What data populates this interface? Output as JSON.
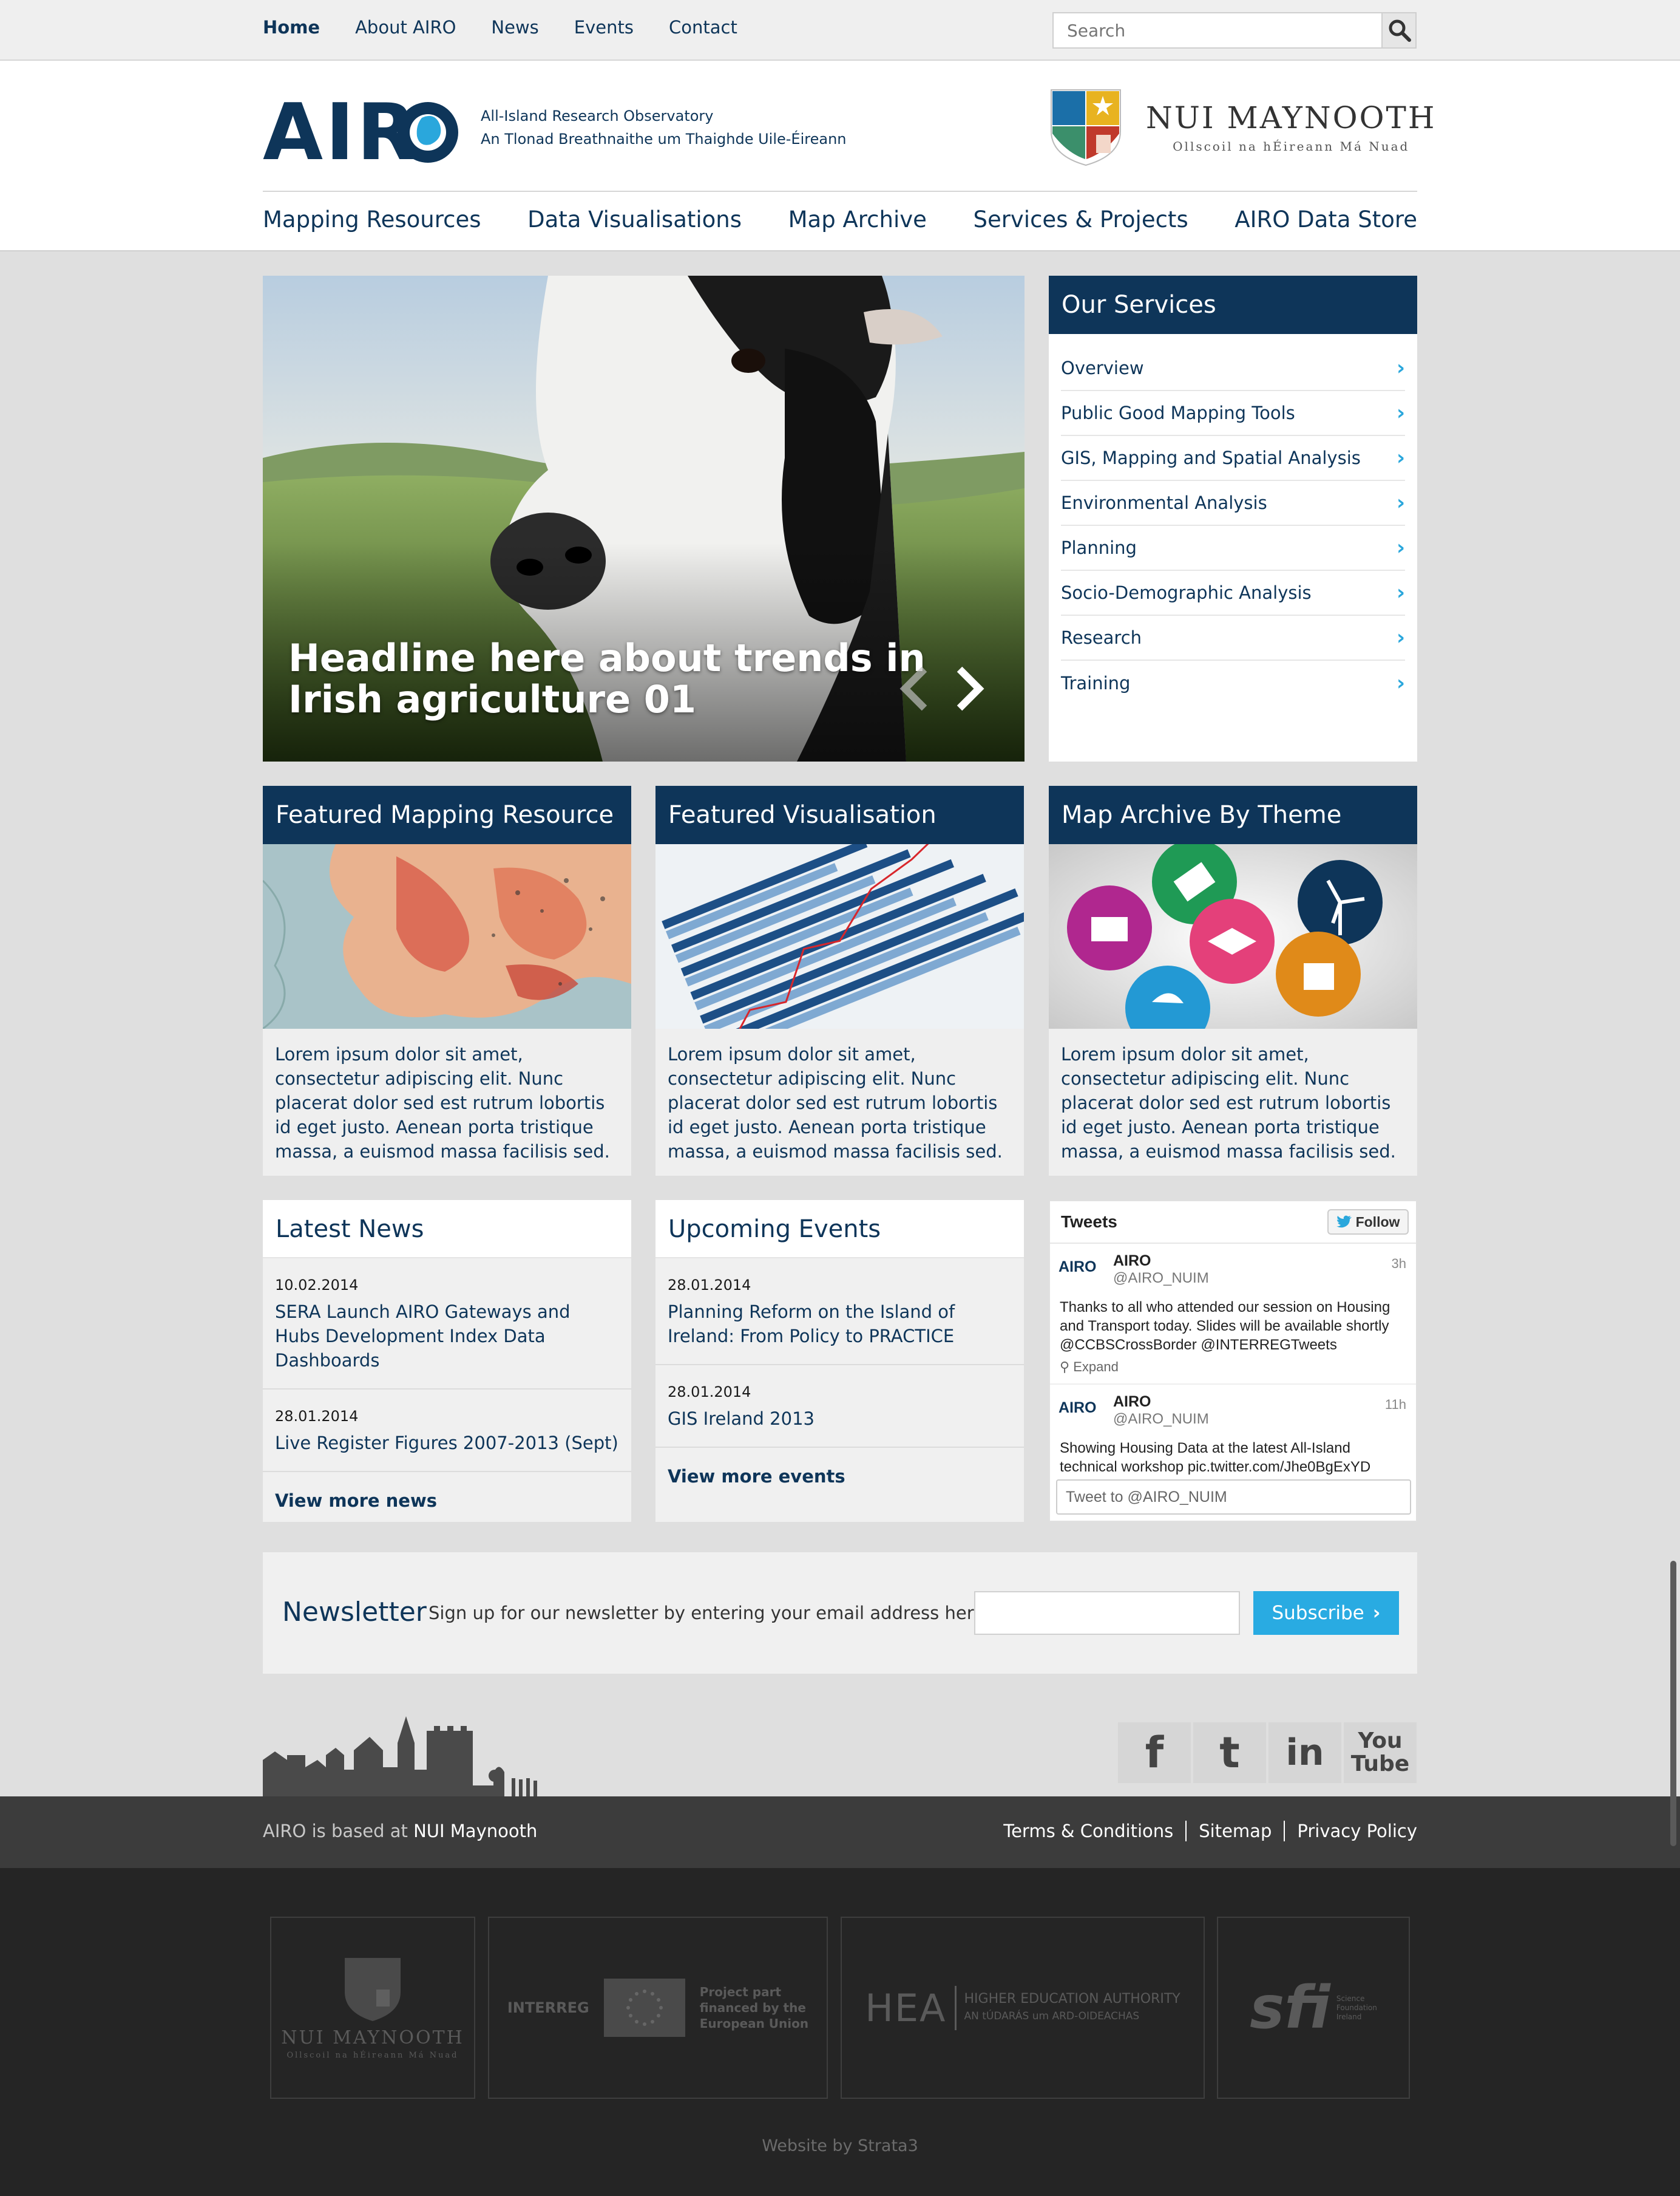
{
  "topnav": {
    "items": [
      "Home",
      "About AIRO",
      "News",
      "Events",
      "Contact"
    ],
    "active": "Home",
    "search_placeholder": "Search"
  },
  "header": {
    "logo_text": "AIRO",
    "tagline_line1": "All-Island Research Observatory",
    "tagline_line2": "An Tlonad Breathnaithe um Thaighde Uile-Éireann",
    "partner_name": "NUI MAYNOOTH",
    "partner_sub": "Ollscoil na hÉireann Má Nuad"
  },
  "mainnav": {
    "items": [
      "Mapping Resources",
      "Data Visualisations",
      "Map Archive",
      "Services & Projects",
      "AIRO Data Store"
    ]
  },
  "hero": {
    "headline_line1": "Headline here about trends in",
    "headline_line2": "Irish agriculture 01"
  },
  "services": {
    "title": "Our Services",
    "items": [
      "Overview",
      "Public Good Mapping Tools",
      "GIS, Mapping and Spatial Analysis",
      "Environmental Analysis",
      "Planning",
      "Socio-Demographic Analysis",
      "Research",
      "Training"
    ]
  },
  "cards": [
    {
      "title": "Featured Mapping Resource",
      "text": "Lorem ipsum dolor sit amet, consectetur adipiscing elit. Nunc placerat dolor sed est rutrum lobortis id eget justo. Aenean porta tristique massa, a euismod massa facilisis sed."
    },
    {
      "title": "Featured Visualisation",
      "text": "Lorem ipsum dolor sit amet, consectetur adipiscing elit. Nunc placerat dolor sed est rutrum lobortis id eget justo. Aenean porta tristique massa, a euismod massa facilisis sed."
    },
    {
      "title": "Map Archive By Theme",
      "text": "Lorem ipsum dolor sit amet, consectetur adipiscing elit. Nunc placerat dolor sed est rutrum lobortis id eget justo. Aenean porta tristique massa, a euismod massa facilisis sed."
    }
  ],
  "news": {
    "title": "Latest News",
    "items": [
      {
        "date": "10.02.2014",
        "title": "SERA Launch AIRO Gateways and Hubs Development Index Data Dashboards"
      },
      {
        "date": "28.01.2014",
        "title": "Live Register Figures 2007-2013 (Sept)"
      }
    ],
    "more": "View more news"
  },
  "events": {
    "title": "Upcoming Events",
    "items": [
      {
        "date": "28.01.2014",
        "title": "Planning Reform on the Island of Ireland: From Policy to PRACTICE"
      },
      {
        "date": "28.01.2014",
        "title": "GIS Ireland 2013"
      }
    ],
    "more": "View more events"
  },
  "tweets": {
    "title": "Tweets",
    "follow": "Follow",
    "items": [
      {
        "avatar": "AIRO",
        "name": "AIRO",
        "handle": "@AIRO_NUIM",
        "time": "3h",
        "text": "Thanks to all who attended our session on Housing and Transport today. Slides will be available shortly @CCBSCrossBorder @INTERREGTweets",
        "expand": "Expand"
      },
      {
        "avatar": "AIRO",
        "name": "AIRO",
        "handle": "@AIRO_NUIM",
        "time": "11h",
        "text": "Showing Housing Data at the latest All-Island technical workshop pic.twitter.com/Jhe0BgExYD"
      }
    ],
    "compose_placeholder": "Tweet to @AIRO_NUIM"
  },
  "newsletter": {
    "title": "Newsletter",
    "text": "Sign up for our newsletter by entering your email address here",
    "button": "Subscribe"
  },
  "social": {
    "facebook": "f",
    "twitter": "t",
    "linkedin": "in",
    "youtube_line1": "You",
    "youtube_line2": "Tube"
  },
  "footer": {
    "based_prefix": "AIRO is based at",
    "based_link": "NUI Maynooth",
    "links": [
      "Terms & Conditions",
      "Sitemap",
      "Privacy Policy"
    ],
    "partners": {
      "nui_name": "NUI MAYNOOTH",
      "nui_sub": "Ollscoil na hÉireann Má Nuad",
      "interreg": "INTERREG",
      "interreg_note_1": "Project part",
      "interreg_note_2": "financed by the",
      "interreg_note_3": "European Union",
      "hea_abbr": "HEA",
      "hea_line1": "HIGHER EDUCATION AUTHORITY",
      "hea_line2": "AN tÚDARÁS um ARD-OIDEACHAS",
      "sfi_abbr": "sfi",
      "sfi_line1": "Science",
      "sfi_line2": "Foundation",
      "sfi_line3": "Ireland"
    },
    "credit": "Website by Strata3"
  },
  "colors": {
    "navy": "#0e3559",
    "accent": "#29abe2",
    "footer_dark": "#252525"
  }
}
